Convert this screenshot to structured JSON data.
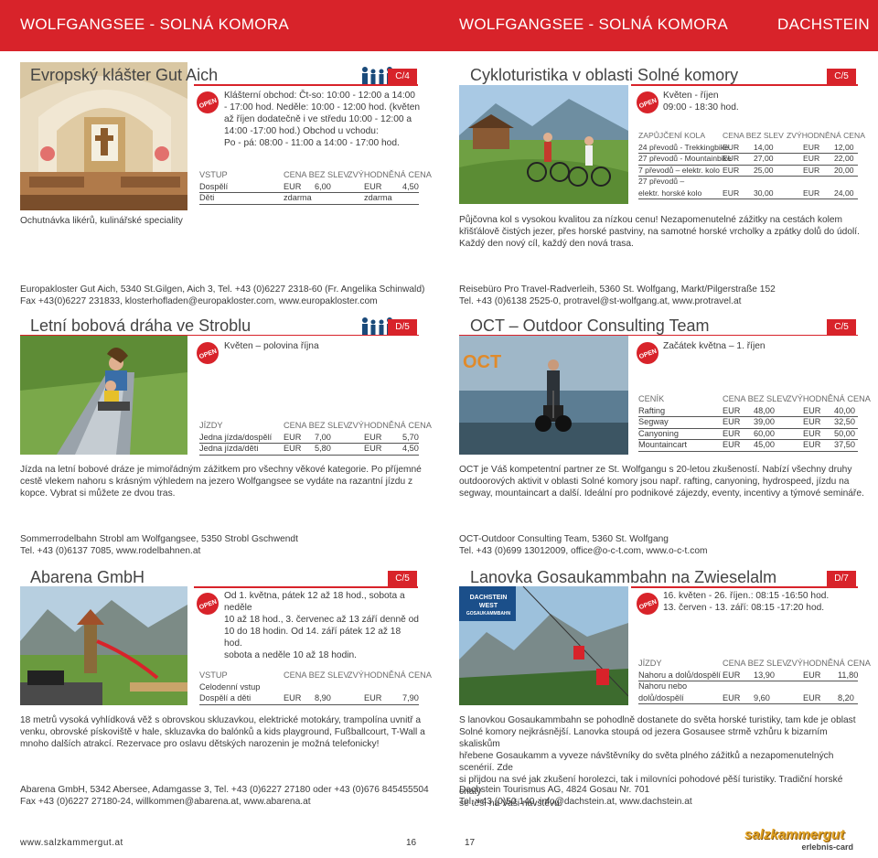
{
  "header": {
    "left": "WOLFGANGSEE - SOLNÁ KOMORA",
    "mid": "WOLFGANGSEE - SOLNÁ KOMORA",
    "right": "DACHSTEIN"
  },
  "open_label": "OPEN",
  "colors": {
    "accent": "#d8232a",
    "text": "#3a3a3a"
  },
  "s1": {
    "title": "Evropský klášter Gut Aich",
    "badge": "C/4",
    "hours": [
      "Klášterní obchod: Čt-so: 10:00 - 12:00 a 14:00",
      "- 17:00 hod. Neděle: 10:00 - 12:00 hod. (květen",
      "až říjen dodatečně i ve středu 10:00 - 12:00 a",
      "14:00 -17:00 hod.) Obchod u vchodu:",
      "Po - pá: 08:00 - 11:00 a 14:00 - 17:00 hod."
    ],
    "table": {
      "h": [
        "VSTUP",
        "CENA BEZ SLEV",
        "ZVÝHODNĚNÁ CENA"
      ],
      "r1": [
        "Dospělí",
        "EUR",
        "6,00",
        "EUR",
        "4,50"
      ],
      "r2": [
        "Děti",
        "zdarma",
        "zdarma"
      ]
    },
    "caption": "Ochutnávka likérů, kulinářské speciality",
    "address": [
      "Europakloster Gut Aich, 5340 St.Gilgen, Aich 3, Tel. +43 (0)6227 2318-60 (Fr. Angelika Schinwald)",
      "Fax +43(0)6227 231833, klosterhofladen@europakloster.com, www.europakloster.com"
    ]
  },
  "s2": {
    "title": "Cykloturistika v oblasti Solné komory",
    "badge": "C/5",
    "hours": [
      "Květen - říjen",
      "09:00 - 18:30 hod."
    ],
    "table": {
      "h": [
        "ZAPŮJČENÍ KOLA",
        "CENA BEZ SLEV",
        "ZVÝHODNĚNÁ CENA"
      ],
      "rows": [
        [
          "24 převodů - Trekkingbike",
          "EUR",
          "14,00",
          "EUR",
          "12,00"
        ],
        [
          "27 převodů - Mountainbike",
          "EUR",
          "27,00",
          "EUR",
          "22,00"
        ],
        [
          "7 převodů – elektr. kolo",
          "EUR",
          "25,00",
          "EUR",
          "20,00"
        ],
        [
          "27 převodů –",
          "",
          "",
          "",
          ""
        ],
        [
          "elektr. horské kolo",
          "EUR",
          "30,00",
          "EUR",
          "24,00"
        ]
      ]
    },
    "desc": [
      "Půjčovna kol s vysokou kvalitou za nízkou cenu! Nezapomenutelné zážitky na cestách kolem",
      "křišťálově čistých jezer, přes horské pastviny, na samotné horské vrcholky a zpátky dolů do údolí.",
      "Každý den nový cíl, každý den nová trasa."
    ],
    "address": [
      "Reisebüro Pro Travel-Radverleih, 5360 St. Wolfgang, Markt/Pilgerstraße 152",
      "Tel. +43 (0)6138 2525-0, protravel@st-wolfgang.at, www.protravel.at"
    ]
  },
  "s3": {
    "title": "Letní bobová dráha ve Stroblu",
    "badge": "D/5",
    "hours": [
      "Květen – polovina října"
    ],
    "table": {
      "h": [
        "JÍZDY",
        "CENA BEZ SLEV",
        "ZVÝHODNĚNÁ CENA"
      ],
      "rows": [
        [
          "Jedna jízda/dospělí",
          "EUR",
          "7,00",
          "EUR",
          "5,70"
        ],
        [
          "Jedna jízda/děti",
          "EUR",
          "5,80",
          "EUR",
          "4,50"
        ]
      ]
    },
    "desc": [
      "Jízda na letní bobové dráze je mimořádným zážitkem pro všechny věkové kategorie. Po příjemné",
      "cestě vlekem nahoru s krásným výhledem na jezero Wolfgangsee se vydáte na razantní jízdu z",
      "kopce. Vybrat si můžete ze dvou tras."
    ],
    "address": [
      "Sommerrodelbahn Strobl am Wolfgangsee, 5350 Strobl Gschwendt",
      "Tel. +43 (0)6137 7085, www.rodelbahnen.at"
    ]
  },
  "s4": {
    "title": "OCT – Outdoor Consulting Team",
    "badge": "C/5",
    "hours": [
      "Začátek května – 1. říjen"
    ],
    "logo": "OCT",
    "table": {
      "h": [
        "CENÍK",
        "CENA BEZ SLEV",
        "ZVÝHODNĚNÁ CENA"
      ],
      "rows": [
        [
          "Rafting",
          "EUR",
          "48,00",
          "EUR",
          "40,00"
        ],
        [
          "Segway",
          "EUR",
          "39,00",
          "EUR",
          "32,50"
        ],
        [
          "Canyoning",
          "EUR",
          "60,00",
          "EUR",
          "50,00"
        ],
        [
          "Mountaincart",
          "EUR",
          "45,00",
          "EUR",
          "37,50"
        ]
      ]
    },
    "desc": [
      "OCT je Váš kompetentní partner ze St. Wolfgangu s 20-letou zkušeností. Nabízí všechny druhy",
      "outdoorových aktivit v oblasti Solné komory jsou např. rafting, canyoning, hydrospeed, jízdu na",
      "segway, mountaincart a další. Ideální pro podnikové zájezdy, eventy, incentivy a týmové semináře."
    ],
    "address": [
      "OCT-Outdoor Consulting Team, 5360 St. Wolfgang",
      "Tel. +43 (0)699 13012009, office@o-c-t.com, www.o-c-t.com"
    ]
  },
  "s5": {
    "title": "Abarena GmbH",
    "badge": "C/5",
    "hours": [
      "Od 1. května, pátek 12 až 18 hod., sobota a neděle",
      "10 až 18 hod., 3. červenec až 13 září denně od",
      "10 do 18 hodin. Od 14. září pátek 12 až 18 hod.",
      "sobota a neděle 10 až 18 hodin."
    ],
    "table": {
      "h": [
        "VSTUP",
        "CENA BEZ SLEV",
        "ZVÝHODNĚNÁ CENA"
      ],
      "sub": "Celodenní vstup",
      "rows": [
        [
          "Dospělí a děti",
          "EUR",
          "8,90",
          "EUR",
          "7,90"
        ]
      ]
    },
    "desc": [
      "18 metrů vysoká vyhlídková věž s obrovskou skluzavkou, elektrické motokáry, trampolína uvnitř a",
      "venku, obrovské pískoviště v hale, skluzavka do balónků a kids playground, Fußballcourt, T-Wall a",
      "mnoho dalších atrakcí. Rezervace pro oslavu dětských narozenin je možná telefonicky!"
    ],
    "address": [
      "Abarena GmbH, 5342 Abersee, Adamgasse 3, Tel. +43 (0)6227 27180 oder +43 (0)676 845455504",
      "Fax +43 (0)6227 27180-24, willkommen@abarena.at, www.abarena.at"
    ]
  },
  "s6": {
    "title": "Lanovka Gosaukammbahn na Zwieselalm",
    "badge": "D/7",
    "hours": [
      "16. květen - 26. říjen.: 08:15 -16:50 hod.",
      "13. červen - 13. září: 08:15 -17:20 hod."
    ],
    "logo": [
      "DACHSTEIN WEST",
      "GOSAUKAMMBAHN"
    ],
    "table": {
      "h": [
        "JÍZDY",
        "CENA BEZ SLEV",
        "ZVÝHODNĚNÁ CENA"
      ],
      "rows": [
        [
          "Nahoru a dolů/dospělí",
          "EUR",
          "13,90",
          "EUR",
          "11,80"
        ],
        [
          "Nahoru nebo",
          "",
          "",
          "",
          ""
        ],
        [
          "dolů/dospělí",
          "EUR",
          "9,60",
          "EUR",
          "8,20"
        ]
      ]
    },
    "desc": [
      "S lanovkou Gosaukammbahn se pohodlně dostanete do světa horské turistiky, tam kde je oblast",
      "Solné komory nejkrásnější. Lanovka stoupá od jezera Gosausee strmě vzhůru k bizarním skaliskům",
      "hřebene Gosaukamm a vyveze návštěvníky do světa plného zážitků a nezapomenutelných scenérií. Zde",
      "si přijdou na své jak zkušení horolezci, tak i milovníci pohodové pěší turistiky. Tradiční horské chaty",
      "se těší na Vaši návštěvu."
    ],
    "address": [
      "Dachstein Tourismus AG, 4824 Gosau Nr. 701",
      "Tel. +43 (0)50 140, info@dachstein.at, www.dachstein.at"
    ]
  },
  "footer": {
    "url": "www.salzkammergut.at",
    "page_left": "16",
    "page_right": "17",
    "brand": "salzkammergut",
    "brand_sub": "erlebnis-card"
  }
}
